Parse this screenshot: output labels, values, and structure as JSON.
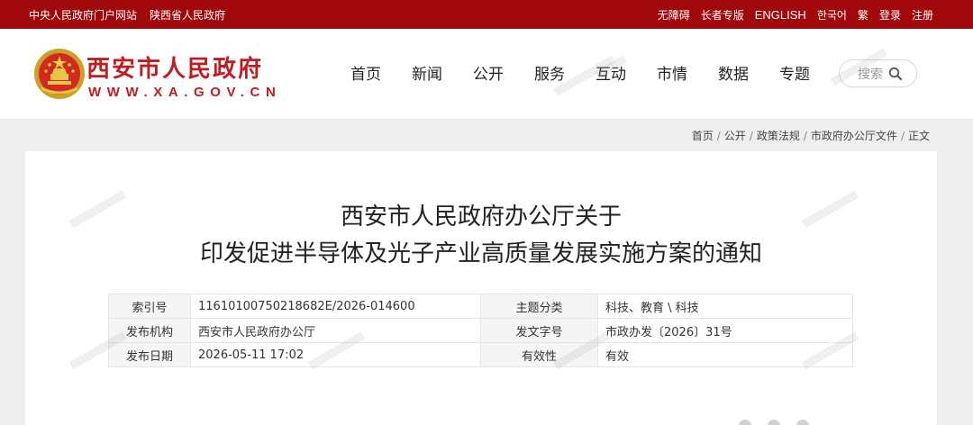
{
  "topbar": {
    "left_links": [
      "中央人民政府门户网站",
      "陕西省人民政府"
    ],
    "right_links": [
      "无障碍",
      "长者专版",
      "ENGLISH",
      "한국어",
      "繁",
      "登录",
      "注册"
    ]
  },
  "header": {
    "site_title": "西安市人民政府",
    "site_domain": "WWW.XA.GOV.CN",
    "nav": [
      "首页",
      "新闻",
      "公开",
      "服务",
      "互动",
      "市情",
      "数据",
      "专题"
    ],
    "search_placeholder": "搜索"
  },
  "breadcrumb": [
    "首页",
    "公开",
    "政策法规",
    "市政府办公厅文件",
    "正文"
  ],
  "article": {
    "title_line1": "西安市人民政府办公厅关于",
    "title_line2": "印发促进半导体及光子产业高质量发展实施方案的通知"
  },
  "meta": {
    "index_label": "索引号",
    "index_value": "11610100750218682E/2026-014600",
    "topic_label": "主题分类",
    "topic_value": "科技、教育 \\ 科技",
    "issuer_label": "发布机构",
    "issuer_value": "西安市人民政府办公厅",
    "docno_label": "发文字号",
    "docno_value": "市政办发〔2026〕31号",
    "date_label": "发布日期",
    "date_value": "2026-05-11 17:02",
    "validity_label": "有效性",
    "validity_value": "有效"
  },
  "colors": {
    "topbar_bg": "#a1080c",
    "brand_red": "#bf1d21"
  },
  "icons": {
    "logo": "national-emblem-icon",
    "search": "search-icon"
  }
}
